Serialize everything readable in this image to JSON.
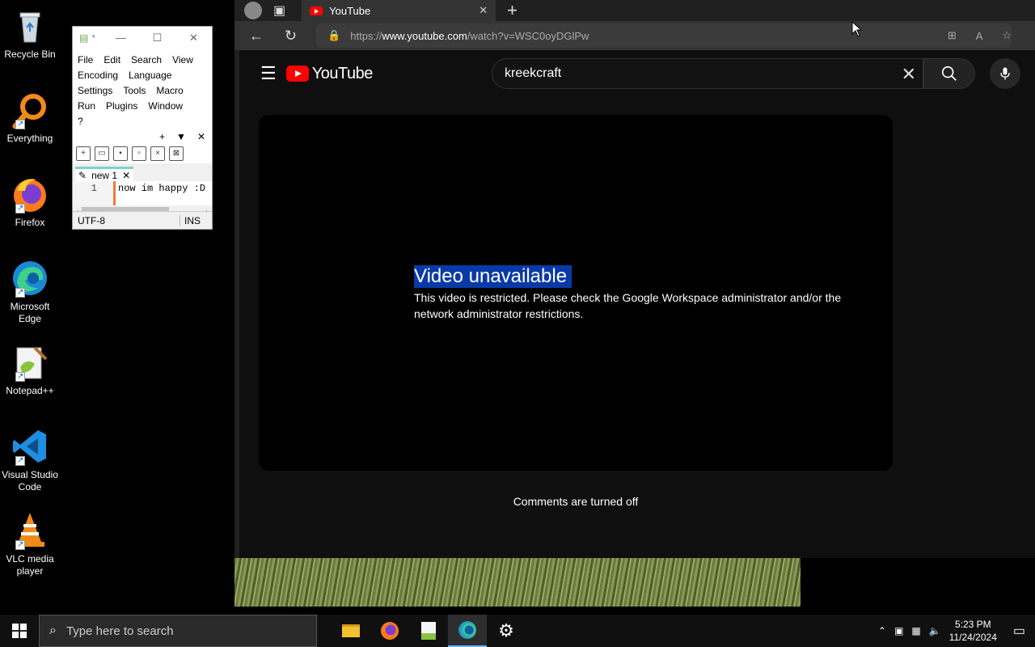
{
  "desktop_icons": [
    {
      "label": "Recycle Bin",
      "icon": "recycle-bin-icon"
    },
    {
      "label": "Everything",
      "icon": "everything-search-icon"
    },
    {
      "label": "Firefox",
      "icon": "firefox-icon"
    },
    {
      "label": "Microsoft Edge",
      "icon": "edge-icon"
    },
    {
      "label": "Notepad++",
      "icon": "notepadpp-icon"
    },
    {
      "label": "Visual Studio Code",
      "icon": "vscode-icon"
    },
    {
      "label": "VLC media player",
      "icon": "vlc-icon"
    }
  ],
  "notepad": {
    "title_marker": "*",
    "menu": [
      "File",
      "Edit",
      "Search",
      "View",
      "Encoding",
      "Language",
      "Settings",
      "Tools",
      "Macro",
      "Run",
      "Plugins",
      "Window",
      "?"
    ],
    "tab_controls": [
      "+",
      "▼",
      "✕"
    ],
    "doc_tab": "new 1",
    "line_number": "1",
    "line_text": "now im happy :D",
    "encoding": "UTF-8",
    "mode": "INS"
  },
  "browser": {
    "tab_title": "YouTube",
    "url_prefix": "https://",
    "url_host": "www.youtube.com",
    "url_path": "/watch?v=WSC0oyDGlPw"
  },
  "youtube": {
    "logo_text": "YouTube",
    "search_value": "kreekcraft",
    "error_title": "Video unavailable",
    "error_message": "This video is restricted. Please check the Google Workspace administrator and/or the network administrator restrictions.",
    "comments_status": "Comments are turned off"
  },
  "taskbar": {
    "search_placeholder": "Type here to search",
    "time": "5:23 PM",
    "date": "11/24/2024"
  },
  "colors": {
    "youtube_red": "#ff0000",
    "selection_blue": "#0a3aa8",
    "page_bg": "#0f0f0f"
  }
}
